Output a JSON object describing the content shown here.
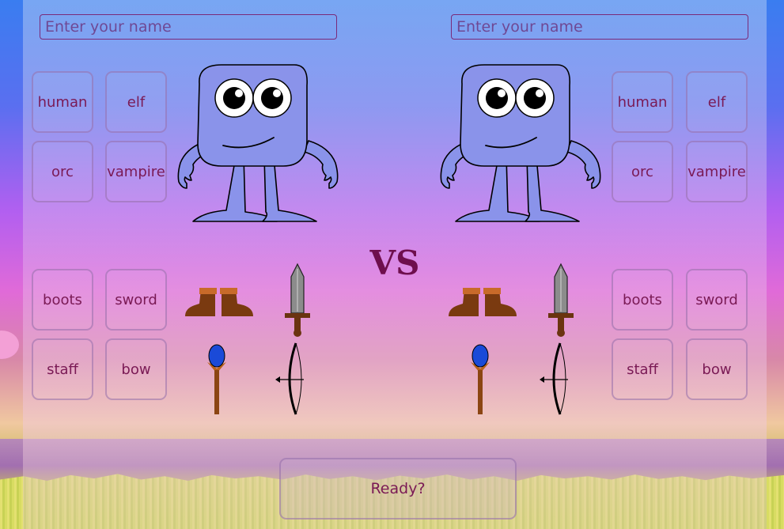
{
  "player1": {
    "name_placeholder": "Enter your name",
    "races": [
      "human",
      "elf",
      "orc",
      "vampire"
    ],
    "items": [
      "boots",
      "sword",
      "staff",
      "bow"
    ]
  },
  "player2": {
    "name_placeholder": "Enter your name",
    "races": [
      "human",
      "elf",
      "orc",
      "vampire"
    ],
    "items": [
      "boots",
      "sword",
      "staff",
      "bow"
    ]
  },
  "versus_label": "VS",
  "ready_label": "Ready?",
  "icons": [
    "monster-avatar",
    "boots-icon",
    "sword-icon",
    "staff-icon",
    "bow-icon"
  ],
  "colors": {
    "monster_body": "#8a93ea",
    "text_accent": "#7a1a55",
    "vs_color": "#6e0f4d"
  }
}
